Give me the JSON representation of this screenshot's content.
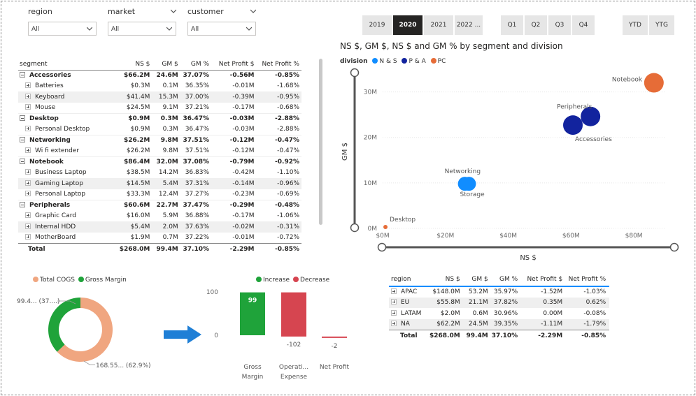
{
  "slicers": [
    {
      "title": "region",
      "value": "All"
    },
    {
      "title": "market",
      "value": "All"
    },
    {
      "title": "customer",
      "value": "All"
    }
  ],
  "year_buttons": [
    "2019",
    "2020",
    "2021",
    "2022 ..."
  ],
  "selected_year": "2020",
  "quarter_buttons": [
    "Q1",
    "Q2",
    "Q3",
    "Q4"
  ],
  "period_buttons": [
    "YTD",
    "YTG"
  ],
  "segment_table": {
    "headers": [
      "segment",
      "NS $",
      "GM $",
      "GM %",
      "Net Profit $",
      "Net Profit %"
    ],
    "rows": [
      {
        "level": "parent",
        "name": "Accessories",
        "ns": "$66.2M",
        "gm": "24.6M",
        "gmp": "37.07%",
        "np": "-0.56M",
        "npp": "-0.85%"
      },
      {
        "level": "child",
        "name": "Batteries",
        "ns": "$0.3M",
        "gm": "0.1M",
        "gmp": "36.35%",
        "np": "-0.01M",
        "npp": "-1.68%"
      },
      {
        "level": "child",
        "name": "Keyboard",
        "ns": "$41.4M",
        "gm": "15.3M",
        "gmp": "37.00%",
        "np": "-0.39M",
        "npp": "-0.95%"
      },
      {
        "level": "child",
        "name": "Mouse",
        "ns": "$24.5M",
        "gm": "9.1M",
        "gmp": "37.21%",
        "np": "-0.17M",
        "npp": "-0.68%"
      },
      {
        "level": "parent",
        "name": "Desktop",
        "ns": "$0.9M",
        "gm": "0.3M",
        "gmp": "36.47%",
        "np": "-0.03M",
        "npp": "-2.88%"
      },
      {
        "level": "child",
        "name": "Personal Desktop",
        "ns": "$0.9M",
        "gm": "0.3M",
        "gmp": "36.47%",
        "np": "-0.03M",
        "npp": "-2.88%"
      },
      {
        "level": "parent",
        "name": "Networking",
        "ns": "$26.2M",
        "gm": "9.8M",
        "gmp": "37.51%",
        "np": "-0.12M",
        "npp": "-0.47%"
      },
      {
        "level": "child",
        "name": "Wi fi extender",
        "ns": "$26.2M",
        "gm": "9.8M",
        "gmp": "37.51%",
        "np": "-0.12M",
        "npp": "-0.47%"
      },
      {
        "level": "parent",
        "name": "Notebook",
        "ns": "$86.4M",
        "gm": "32.0M",
        "gmp": "37.08%",
        "np": "-0.79M",
        "npp": "-0.92%"
      },
      {
        "level": "child",
        "name": "Business Laptop",
        "ns": "$38.5M",
        "gm": "14.2M",
        "gmp": "36.83%",
        "np": "-0.42M",
        "npp": "-1.10%"
      },
      {
        "level": "child",
        "name": "Gaming Laptop",
        "ns": "$14.5M",
        "gm": "5.4M",
        "gmp": "37.31%",
        "np": "-0.14M",
        "npp": "-0.96%"
      },
      {
        "level": "child",
        "name": "Personal Laptop",
        "ns": "$33.3M",
        "gm": "12.4M",
        "gmp": "37.27%",
        "np": "-0.23M",
        "npp": "-0.69%"
      },
      {
        "level": "parent",
        "name": "Peripherals",
        "ns": "$60.6M",
        "gm": "22.7M",
        "gmp": "37.47%",
        "np": "-0.29M",
        "npp": "-0.48%"
      },
      {
        "level": "child",
        "name": "Graphic Card",
        "ns": "$16.0M",
        "gm": "5.9M",
        "gmp": "36.88%",
        "np": "-0.17M",
        "npp": "-1.06%"
      },
      {
        "level": "child",
        "name": "Internal HDD",
        "ns": "$5.4M",
        "gm": "2.0M",
        "gmp": "37.63%",
        "np": "-0.02M",
        "npp": "-0.31%"
      },
      {
        "level": "child",
        "name": "MotherBoard",
        "ns": "$1.9M",
        "gm": "0.7M",
        "gmp": "37.22%",
        "np": "-0.01M",
        "npp": "-0.72%"
      }
    ],
    "total": {
      "name": "Total",
      "ns": "$268.0M",
      "gm": "99.4M",
      "gmp": "37.10%",
      "np": "-2.29M",
      "npp": "-0.85%"
    }
  },
  "chart_data": [
    {
      "type": "scatter",
      "title": "NS $, GM $, NS $ and GM % by segment and division",
      "xlabel": "NS $",
      "ylabel": "GM $",
      "xticks": [
        "$0M",
        "$20M",
        "$40M",
        "$60M",
        "$80M"
      ],
      "yticks": [
        "0M",
        "10M",
        "20M",
        "30M"
      ],
      "xlim": [
        0,
        90
      ],
      "ylim": [
        0,
        35
      ],
      "legend_title": "division",
      "series": [
        {
          "name": "N & S",
          "color": "#118dff"
        },
        {
          "name": "P & A",
          "color": "#12239e"
        },
        {
          "name": "PC",
          "color": "#e66c37"
        }
      ],
      "points": [
        {
          "label": "Notebook",
          "series": "PC",
          "x": 86.4,
          "y": 32.0,
          "size": 37.08
        },
        {
          "label": "Peripherals",
          "series": "P & A",
          "x": 66.2,
          "y": 24.6,
          "size": 37.07
        },
        {
          "label": "Accessories",
          "series": "P & A",
          "x": 60.6,
          "y": 22.7,
          "size": 37.47
        },
        {
          "label": "Networking",
          "series": "N & S",
          "x": 26.2,
          "y": 9.8,
          "size": 37.51
        },
        {
          "label": "Storage",
          "series": "N & S",
          "x": 27.5,
          "y": 9.8,
          "size": 37.5
        },
        {
          "label": "Desktop",
          "series": "PC",
          "x": 0.9,
          "y": 0.3,
          "size": 5
        }
      ]
    },
    {
      "type": "pie",
      "legend": [
        {
          "name": "Total COGS",
          "color": "#f0a680"
        },
        {
          "name": "Gross Margin",
          "color": "#1fa33a"
        }
      ],
      "slices": [
        {
          "name": "Total COGS",
          "value": 168.55,
          "percent": 62.9,
          "label": "168.55... (62.9%)"
        },
        {
          "name": "Gross Margin",
          "value": 99.4,
          "percent": 37.1,
          "label": "99.4... (37....)"
        }
      ]
    },
    {
      "type": "bar",
      "legend": [
        {
          "name": "Increase",
          "color": "#1fa33a"
        },
        {
          "name": "Decrease",
          "color": "#d64550"
        }
      ],
      "yticks": [
        "100",
        "0"
      ],
      "ylim": [
        0,
        100
      ],
      "bars": [
        {
          "category": "Gross Margin",
          "label_lines": [
            "Gross",
            "Margin"
          ],
          "value": 99,
          "value_label": "99",
          "kind": "Increase"
        },
        {
          "category": "Operating Expense",
          "label_lines": [
            "Operati...",
            "Expense"
          ],
          "value": -102,
          "value_label": "-102",
          "kind": "Decrease"
        },
        {
          "category": "Net Profit",
          "label_lines": [
            "Net Profit"
          ],
          "value": -2,
          "value_label": "-2",
          "kind": "Decrease"
        }
      ]
    }
  ],
  "region_table": {
    "headers": [
      "region",
      "NS $",
      "GM $",
      "GM %",
      "Net Profit $",
      "Net Profit %"
    ],
    "rows": [
      {
        "name": "APAC",
        "ns": "$148.0M",
        "gm": "53.2M",
        "gmp": "35.97%",
        "np": "-1.52M",
        "npp": "-1.03%"
      },
      {
        "name": "EU",
        "ns": "$55.8M",
        "gm": "21.1M",
        "gmp": "37.82%",
        "np": "0.35M",
        "npp": "0.62%"
      },
      {
        "name": "LATAM",
        "ns": "$2.0M",
        "gm": "0.6M",
        "gmp": "30.96%",
        "np": "0.00M",
        "npp": "-0.08%"
      },
      {
        "name": "NA",
        "ns": "$62.2M",
        "gm": "24.5M",
        "gmp": "39.35%",
        "np": "-1.11M",
        "npp": "-1.79%"
      }
    ],
    "total": {
      "name": "Total",
      "ns": "$268.0M",
      "gm": "99.4M",
      "gmp": "37.10%",
      "np": "-2.29M",
      "npp": "-0.85%"
    }
  },
  "icons": {
    "arrow": "right-arrow-icon",
    "chevron": "chevron-down-icon",
    "expand": "plus-box-icon",
    "collapse": "minus-box-icon"
  }
}
